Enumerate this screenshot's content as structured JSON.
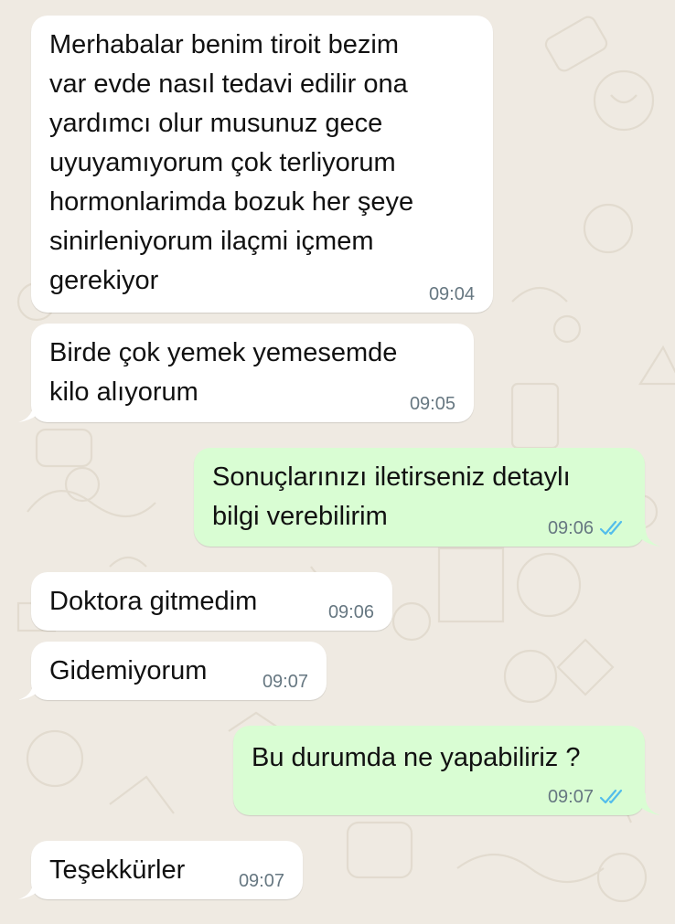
{
  "theme": {
    "incoming_bg": "#ffffff",
    "outgoing_bg": "#d9fdd3",
    "wallpaper": "#efeae2",
    "timestamp_color": "#667781",
    "read_ticks_color": "#53bdeb"
  },
  "messages": [
    {
      "direction": "incoming",
      "text": "Merhabalar benim tiroit bezim\nvar evde nasıl tedavi edilir ona\nyardımcı olur musunuz gece\nuyuyamıyorum çok terliyorum\nhormonlarimda bozuk her şeye\nsinirleniyorum ilaçmi içmem\ngerekiyor",
      "time": "09:04"
    },
    {
      "direction": "incoming",
      "text": "Birde çok yemek yemesemde\nkilo alıyorum",
      "time": "09:05"
    },
    {
      "direction": "outgoing",
      "text": "Sonuçlarınızı iletirseniz detaylı\nbilgi verebilirim",
      "time": "09:06",
      "status_icon": "double-check-read-icon"
    },
    {
      "direction": "incoming",
      "text": "Doktora gitmedim",
      "time": "09:06"
    },
    {
      "direction": "incoming",
      "text": "Gidemiyorum",
      "time": "09:07"
    },
    {
      "direction": "outgoing",
      "text": "Bu durumda ne yapabiliriz ?",
      "time": "09:07",
      "status_icon": "double-check-read-icon"
    },
    {
      "direction": "incoming",
      "text": "Teşekkürler",
      "time": "09:07"
    }
  ]
}
